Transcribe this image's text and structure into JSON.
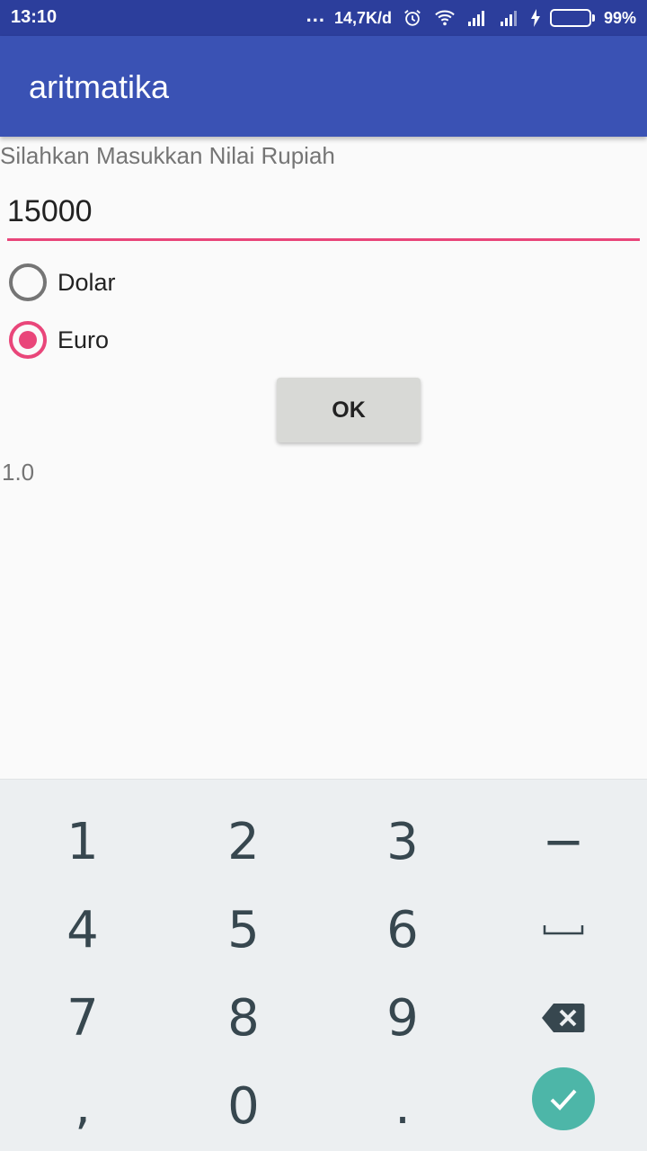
{
  "status_bar": {
    "time": "13:10",
    "dots": "...",
    "network_speed": "14,7K/d",
    "battery_percent": "99%",
    "battery_level": 0.99,
    "icons": [
      "alarm-icon",
      "wifi-icon",
      "signal-icon",
      "signal-icon",
      "charging-icon",
      "battery-icon"
    ]
  },
  "app_bar": {
    "title": "aritmatika"
  },
  "form": {
    "prompt": "Silahkan Masukkan Nilai Rupiah",
    "input_value": "15000",
    "radio_options": [
      {
        "label": "Dolar",
        "checked": false
      },
      {
        "label": "Euro",
        "checked": true
      }
    ],
    "ok_label": "OK",
    "result": "1.0"
  },
  "keyboard": {
    "keys": [
      "1",
      "2",
      "3",
      "−",
      "4",
      "5",
      "6",
      "␣",
      "7",
      "8",
      "9",
      "backspace",
      ",",
      "0",
      ".",
      "enter"
    ]
  },
  "colors": {
    "status_bar": "#2c3e9c",
    "app_bar": "#3a52b4",
    "accent": "#e9467a",
    "keyboard_bg": "#eceff1",
    "enter_key": "#4db6a8"
  }
}
